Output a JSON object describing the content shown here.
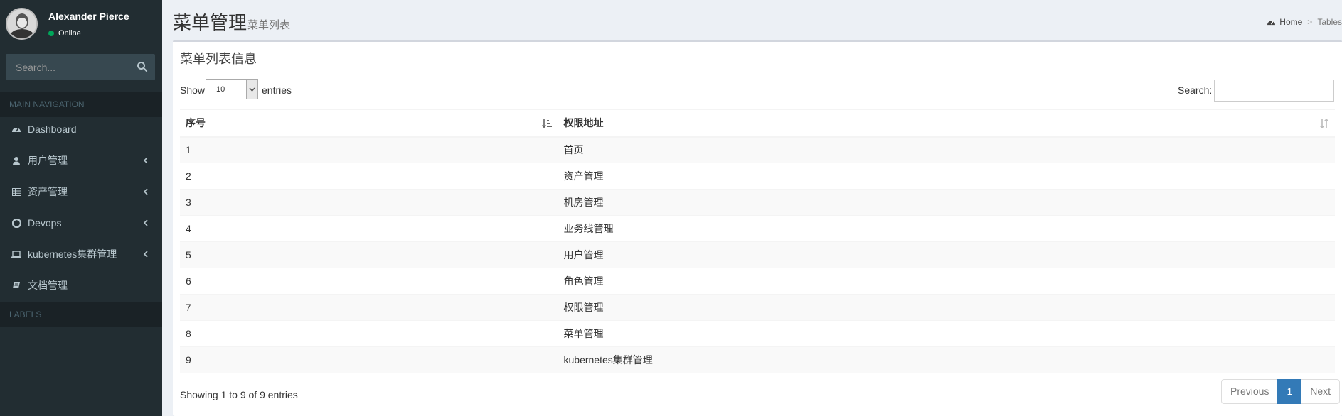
{
  "user": {
    "name": "Alexander Pierce",
    "status": "Online"
  },
  "sidebar": {
    "search_placeholder": "Search...",
    "main_nav_header": "MAIN NAVIGATION",
    "labels_header": "LABELS",
    "items": [
      {
        "label": "Dashboard",
        "icon": "dashboard-icon",
        "has_children": false
      },
      {
        "label": "用户管理",
        "icon": "user-icon",
        "has_children": true
      },
      {
        "label": "资产管理",
        "icon": "table-icon",
        "has_children": true
      },
      {
        "label": "Devops",
        "icon": "opera-icon",
        "has_children": true
      },
      {
        "label": "kubernetes集群管理",
        "icon": "laptop-icon",
        "has_children": true
      },
      {
        "label": "文档管理",
        "icon": "book-icon",
        "has_children": false
      }
    ]
  },
  "header": {
    "title": "菜单管理",
    "subtitle": "菜单列表"
  },
  "breadcrumb": {
    "home": "Home",
    "current": "Tables"
  },
  "box": {
    "title": "菜单列表信息",
    "show_label": "Show",
    "page_length": "10",
    "entries_label": "entries",
    "search_label": "Search:",
    "search_value": ""
  },
  "table": {
    "columns": [
      "序号",
      "权限地址"
    ],
    "rows": [
      [
        "1",
        "首页"
      ],
      [
        "2",
        "资产管理"
      ],
      [
        "3",
        "机房管理"
      ],
      [
        "4",
        "业务线管理"
      ],
      [
        "5",
        "用户管理"
      ],
      [
        "6",
        "角色管理"
      ],
      [
        "7",
        "权限管理"
      ],
      [
        "8",
        "菜单管理"
      ],
      [
        "9",
        "kubernetes集群管理"
      ]
    ]
  },
  "footer": {
    "info": "Showing 1 to 9 of 9 entries",
    "previous": "Previous",
    "current_page": "1",
    "next": "Next"
  },
  "colors": {
    "sidebar_bg": "#222d32",
    "accent": "#337ab7",
    "online": "#00a65a"
  }
}
